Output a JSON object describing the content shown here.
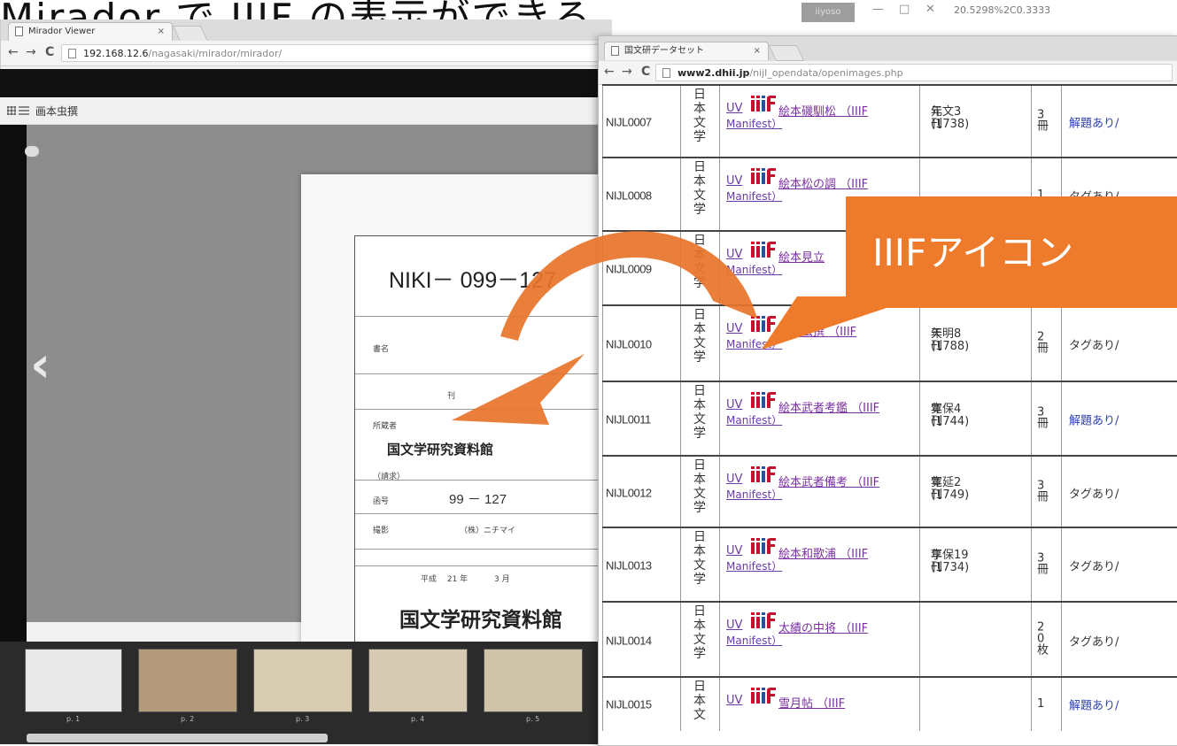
{
  "heading": "Mirador で IIIF の表示ができる",
  "left_window": {
    "tab_title": "Mirador Viewer",
    "tab_close": "×",
    "url_host": "192.168.12.6",
    "url_path": "/nagasaki/mirador/mirador/",
    "viewer_title": "画本虫撰",
    "label_card": {
      "code": "NIKI－ 099－127",
      "row_labels": [
        "書名",
        "刊",
        "所蔵者",
        "（請求）",
        "函号",
        "撮影"
      ],
      "institution": "国文学研究資料館",
      "number": "99 － 127",
      "photographer": "（株）ニチマイ",
      "date_line": "平成　 21 年　　　 3 月",
      "bottom_text": "国文学研究資料館"
    },
    "thumbs": [
      "p. 1",
      "p. 2",
      "p. 3",
      "p. 4",
      "p. 5"
    ]
  },
  "right_window": {
    "tab_title": "国文研データセット",
    "tab_close": "×",
    "url_host": "www2.dhii.jp",
    "url_path": "/nijl_opendata/openimages.php",
    "system_user": "iiyoso",
    "system_coord": "20.5298%2C0.3333",
    "rows": [
      {
        "id": "NIJL0007",
        "category": "日本文学",
        "uv": "UV",
        "title": "絵本磯馴松",
        "manifest_open": "（IIIF",
        "manifest": "Manifest）",
        "date_1": "元文3 (1738)",
        "date_2": "年 刊",
        "volume": "3冊",
        "note": "解題あり/",
        "note_type": "link"
      },
      {
        "id": "NIJL0008",
        "category": "日本文学",
        "uv": "UV",
        "title": "絵本松の調",
        "manifest_open": "（IIIF",
        "manifest": "Manifest）",
        "date_1": "",
        "date_2": "",
        "volume": "1",
        "note": "タグあり/",
        "note_type": "plain"
      },
      {
        "id": "NIJL0009",
        "category": "日本文学",
        "uv": "UV",
        "title": "絵本見立",
        "manifest_open": "",
        "manifest": "Manifest）",
        "date_1": "",
        "date_2": "",
        "volume": "",
        "note": "",
        "note_type": "plain"
      },
      {
        "id": "NIJL0010",
        "category": "日本文学",
        "uv": "UV",
        "title": "画本虫撰",
        "manifest_open": "（IIIF",
        "manifest": "Manifest）",
        "date_1": "天明8 (1788)",
        "date_2": "年 刊",
        "volume": "2冊",
        "note": "タグあり/",
        "note_type": "plain"
      },
      {
        "id": "NIJL0011",
        "category": "日本文学",
        "uv": "UV",
        "title": "絵本武者考鑑",
        "manifest_open": "（IIIF",
        "manifest": "Manifest）",
        "date_1": "寛保4 (1744)",
        "date_2": "年 刊",
        "volume": "3冊",
        "note": "解題あり/",
        "note_type": "link"
      },
      {
        "id": "NIJL0012",
        "category": "日本文学",
        "uv": "UV",
        "title": "絵本武者備考",
        "manifest_open": "（IIIF",
        "manifest": "Manifest）",
        "date_1": "寛延2 (1749)",
        "date_2": "年 刊",
        "volume": "3冊",
        "note": "タグあり/",
        "note_type": "plain"
      },
      {
        "id": "NIJL0013",
        "category": "日本文学",
        "uv": "UV",
        "title": "絵本和歌浦",
        "manifest_open": "（IIIF",
        "manifest": "Manifest）",
        "date_1": "享保19 (1734)",
        "date_2": "年 刊",
        "volume": "3冊",
        "note": "タグあり/",
        "note_type": "plain"
      },
      {
        "id": "NIJL0014",
        "category": "日本文学",
        "uv": "UV",
        "title": "太績の中将",
        "manifest_open": "（IIIF",
        "manifest": "Manifest）",
        "date_1": "",
        "date_2": "",
        "volume": "20枚",
        "note": "タグあり/",
        "note_type": "plain"
      },
      {
        "id": "NIJL0015",
        "category": "日本文",
        "uv": "UV",
        "title": "雪月帖",
        "manifest_open": "（IIIF",
        "manifest": "",
        "date_1": "",
        "date_2": "",
        "volume": "1",
        "note": "解題あり/",
        "note_type": "link"
      }
    ]
  },
  "callout_text": "IIIFアイコン",
  "colors": {
    "accent": "#ee7a2b",
    "iiif_red": "#c8102e",
    "iiif_blue": "#2a4fa0"
  }
}
